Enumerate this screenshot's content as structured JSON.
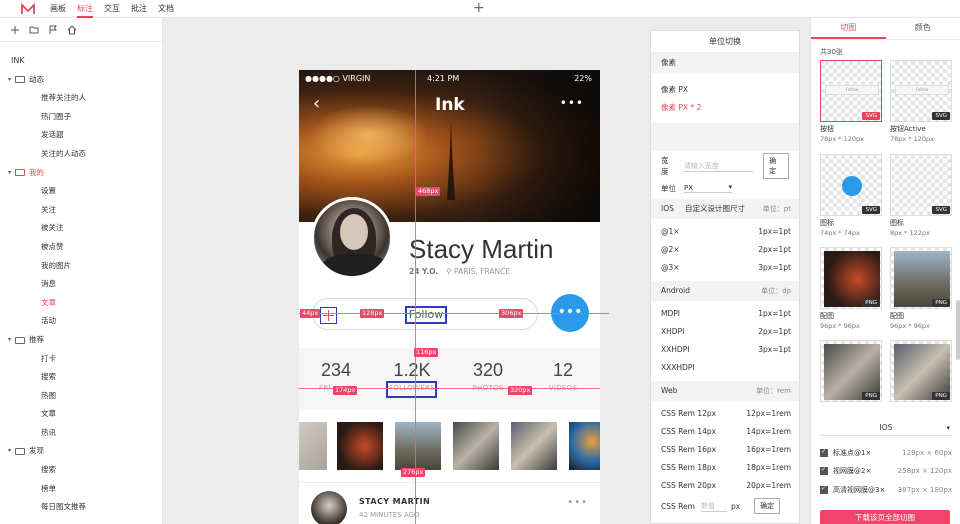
{
  "topbar": {
    "nav": [
      "画板",
      "标注",
      "交互",
      "批注",
      "文档"
    ],
    "active": "标注"
  },
  "sidebar": {
    "root": "INK",
    "groups": [
      {
        "label": "动态",
        "items": [
          "推荐关注的人",
          "热门圈子",
          "发话题",
          "关注的人动态"
        ]
      },
      {
        "label": "我的",
        "items": [
          "设置",
          "关注",
          "被关注",
          "被点赞",
          "我的图片",
          "消息",
          "文章",
          "活动"
        ]
      },
      {
        "label": "推荐",
        "items": [
          "打卡",
          "搜索",
          "热图",
          "文章",
          "热讯"
        ]
      },
      {
        "label": "发现",
        "items": [
          "搜索",
          "榜单",
          "每日图文推荐"
        ]
      }
    ],
    "active_group": "我的",
    "active_item": "文章"
  },
  "phone": {
    "carrier": "●●●●○ VIRGIN",
    "time": "4:21 PM",
    "battery": "22%",
    "title": "Ink",
    "name": "Stacy Martin",
    "age": "24 Y.O.",
    "location": "PARIS, FRANCE",
    "follow": "Follow",
    "stats": [
      {
        "value": "234",
        "label": "FRI"
      },
      {
        "value": "1.2K",
        "label": "FOLLOWERS"
      },
      {
        "value": "320",
        "label": "PHOTOS"
      },
      {
        "value": "12",
        "label": "VIDEOS"
      }
    ],
    "feed_name": "STACY MARTIN",
    "feed_time": "42 MINUTES AGO"
  },
  "measurements": [
    "468px",
    "44px",
    "128px",
    "306px",
    "116px",
    "174px",
    "320px",
    "276px"
  ],
  "unit_panel": {
    "title": "单位切换",
    "pixel_section": "像素",
    "pixel_px": "像素 PX",
    "pixel_px2": "像素 PX * 2",
    "width_label": "宽度",
    "width_placeholder": "请输入宽度",
    "confirm": "确定",
    "unit_label": "单位",
    "unit_value": "PX",
    "ios": {
      "label": "IOS",
      "mid": "自定义设计图尺寸",
      "unit": "单位：pt",
      "rows": [
        [
          "@1×",
          "1px=1pt"
        ],
        [
          "@2×",
          "2px=1pt"
        ],
        [
          "@3×",
          "3px=1pt"
        ]
      ]
    },
    "android": {
      "label": "Android",
      "unit": "单位：dp",
      "rows": [
        [
          "MDPI",
          "1px=1pt"
        ],
        [
          "XHDPI",
          "2px=1pt"
        ],
        [
          "XXHDPI",
          "3px=1pt"
        ],
        [
          "XXXHDPI",
          ""
        ]
      ]
    },
    "web": {
      "label": "Web",
      "unit": "单位：rem",
      "rows": [
        [
          "CSS Rem 12px",
          "12px=1rem"
        ],
        [
          "CSS Rem 14px",
          "14px=1rem"
        ],
        [
          "CSS Rem 16px",
          "16px=1rem"
        ],
        [
          "CSS Rem 18px",
          "18px=1rem"
        ],
        [
          "CSS Rem 20px",
          "20px=1rem"
        ]
      ]
    },
    "rem_label": "CSS Rem",
    "rem_placeholder": "数值",
    "rem_unit": "px"
  },
  "right_panel": {
    "tabs": [
      "切图",
      "颜色"
    ],
    "count": "共30张",
    "slices": [
      {
        "cap": "按钮",
        "dim": "78px * 120px",
        "badge": "SVG"
      },
      {
        "cap": "按钮Active",
        "dim": "78px * 120px",
        "badge": "SVG"
      },
      {
        "cap": "图标",
        "dim": "74px * 74px",
        "badge": "SVG"
      },
      {
        "cap": "图标",
        "dim": "8px * 122px",
        "badge": "SVG"
      },
      {
        "cap": "配图",
        "dim": "96px * 96px",
        "badge": "PNG"
      },
      {
        "cap": "配图",
        "dim": "96px * 96px",
        "badge": "PNG"
      },
      {
        "cap": "",
        "dim": "",
        "badge": "PNG"
      },
      {
        "cap": "",
        "dim": "",
        "badge": "PNG"
      }
    ],
    "bar_text": "Follow",
    "platform": "IOS",
    "checks": [
      {
        "label": "标准点@1×",
        "dim": "129px × 60px"
      },
      {
        "label": "视网膜@2×",
        "dim": "258px × 120px"
      },
      {
        "label": "高清视网膜@3×",
        "dim": "387px × 180px"
      }
    ],
    "download": "下载该页全部切图"
  },
  "colors": {
    "accent": "#e8455b",
    "measure": "#f0456a",
    "chat_blue": "#2a9ae8",
    "select_blue": "#2f3db5"
  }
}
